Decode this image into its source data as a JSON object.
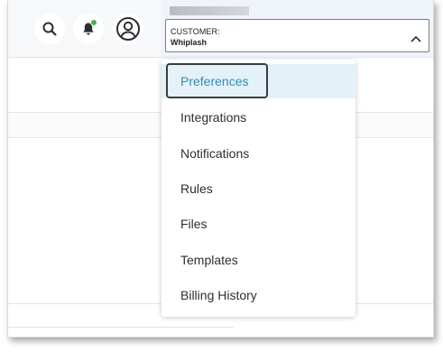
{
  "header": {
    "icons": [
      "search-icon",
      "bell-icon",
      "user-account-icon"
    ],
    "notification_indicator_color": "#4caf50"
  },
  "customer": {
    "label": "CUSTOMER:",
    "value": "Whiplash"
  },
  "menu": {
    "items": [
      {
        "label": "Preferences",
        "active": true
      },
      {
        "label": "Integrations"
      },
      {
        "label": "Notifications"
      },
      {
        "label": "Rules"
      },
      {
        "label": "Files"
      },
      {
        "label": "Templates"
      },
      {
        "label": "Billing History"
      }
    ],
    "accent_color": "#2f8fb8",
    "active_bg": "#e4f1f8"
  }
}
